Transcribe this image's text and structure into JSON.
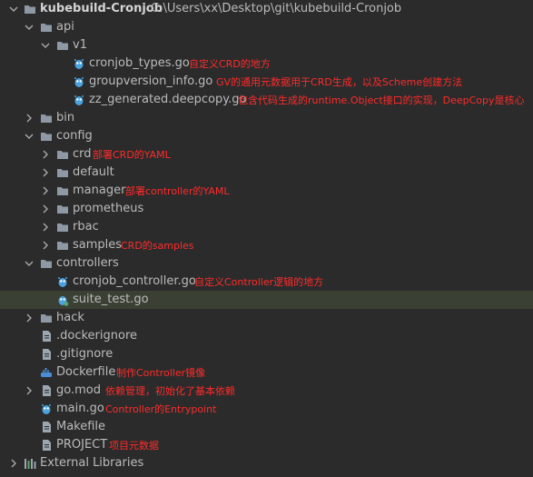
{
  "project": {
    "name": "kubebuild-Cronjob",
    "path": "C:\\Users\\xx\\Desktop\\git\\kubebuild-Cronjob"
  },
  "tree": {
    "api": "api",
    "v1": "v1",
    "cronjob_types": "cronjob_types.go",
    "groupversion_info": "groupversion_info.go",
    "zz_generated": "zz_generated.deepcopy.go",
    "bin": "bin",
    "config": "config",
    "crd": "crd",
    "default": "default",
    "manager": "manager",
    "prometheus": "prometheus",
    "rbac": "rbac",
    "samples": "samples",
    "controllers": "controllers",
    "cronjob_controller": "cronjob_controller.go",
    "suite_test": "suite_test.go",
    "hack": "hack",
    "dockerignore": ".dockerignore",
    "gitignore": ".gitignore",
    "dockerfile": "Dockerfile",
    "gomod": "go.mod",
    "maingo": "main.go",
    "makefile": "Makefile",
    "project_file": "PROJECT",
    "external_libraries": "External Libraries"
  },
  "notes": {
    "cronjob_types": "自定义CRD的地方",
    "groupversion_info": "GV的通用元数据用于CRD生成，以及Scheme创建方法",
    "zz_generated": "包含代码生成的runtime.Object接口的实现，DeepCopy是核心",
    "crd": "部署CRD的YAML",
    "manager": "部署controller的YAML",
    "samples": "CRD的samples",
    "cronjob_controller": "自定义Controller逻辑的地方",
    "dockerfile": "制作Controller镜像",
    "gomod": "依赖管理，初始化了基本依赖",
    "maingo": "Controller的Entrypoint",
    "project_file": "项目元数据"
  },
  "colors": {
    "background": "#2b2b2b",
    "selected_row": "#3b4034",
    "annotation": "#ff2b2b",
    "folder": "#8d9aa6",
    "go_file": "#4aa3df"
  },
  "selected_item": "suite_test.go"
}
